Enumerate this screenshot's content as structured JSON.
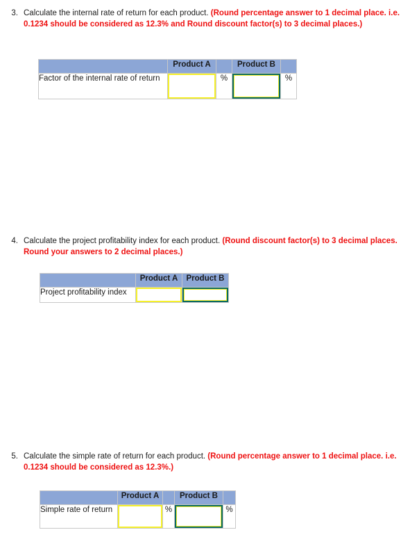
{
  "colors": {
    "header_blue": "#8ca6d6",
    "note_red": "#ee1111",
    "input_a_border": "#f5f02a",
    "input_b_border": "#0b6a5e",
    "grid_line": "#c8c8c8"
  },
  "questions": [
    {
      "number": "3.",
      "prompt": "Calculate the internal rate of return for each product.",
      "note": "(Round percentage answer to 1 decimal place. i.e. 0.1234 should be considered as 12.3% and Round discount factor(s) to 3 decimal places.)",
      "table": {
        "corner_header": "",
        "columns": [
          "Product A",
          "Product B"
        ],
        "percent_symbol": "%",
        "has_percent_columns": true,
        "rows": [
          {
            "label": "Factor of the internal rate of return",
            "values": [
              "",
              ""
            ]
          }
        ]
      }
    },
    {
      "number": "4.",
      "prompt": "Calculate the project profitability index for each product.",
      "note": "(Round discount factor(s) to 3 decimal places. Round your answers to 2 decimal places.)",
      "table": {
        "corner_header": "",
        "columns": [
          "Product A",
          "Product B"
        ],
        "percent_symbol": "",
        "has_percent_columns": false,
        "rows": [
          {
            "label": "Project profitability index",
            "values": [
              "",
              ""
            ]
          }
        ]
      }
    },
    {
      "number": "5.",
      "prompt": "Calculate the simple rate of return for each product.",
      "note": "(Round percentage answer to 1 decimal place. i.e. 0.1234 should be considered as 12.3%.)",
      "table": {
        "corner_header": "",
        "columns": [
          "Product A",
          "Product B"
        ],
        "percent_symbol": "%",
        "has_percent_columns": true,
        "rows": [
          {
            "label": "Simple rate of return",
            "values": [
              "",
              ""
            ]
          }
        ]
      }
    }
  ]
}
